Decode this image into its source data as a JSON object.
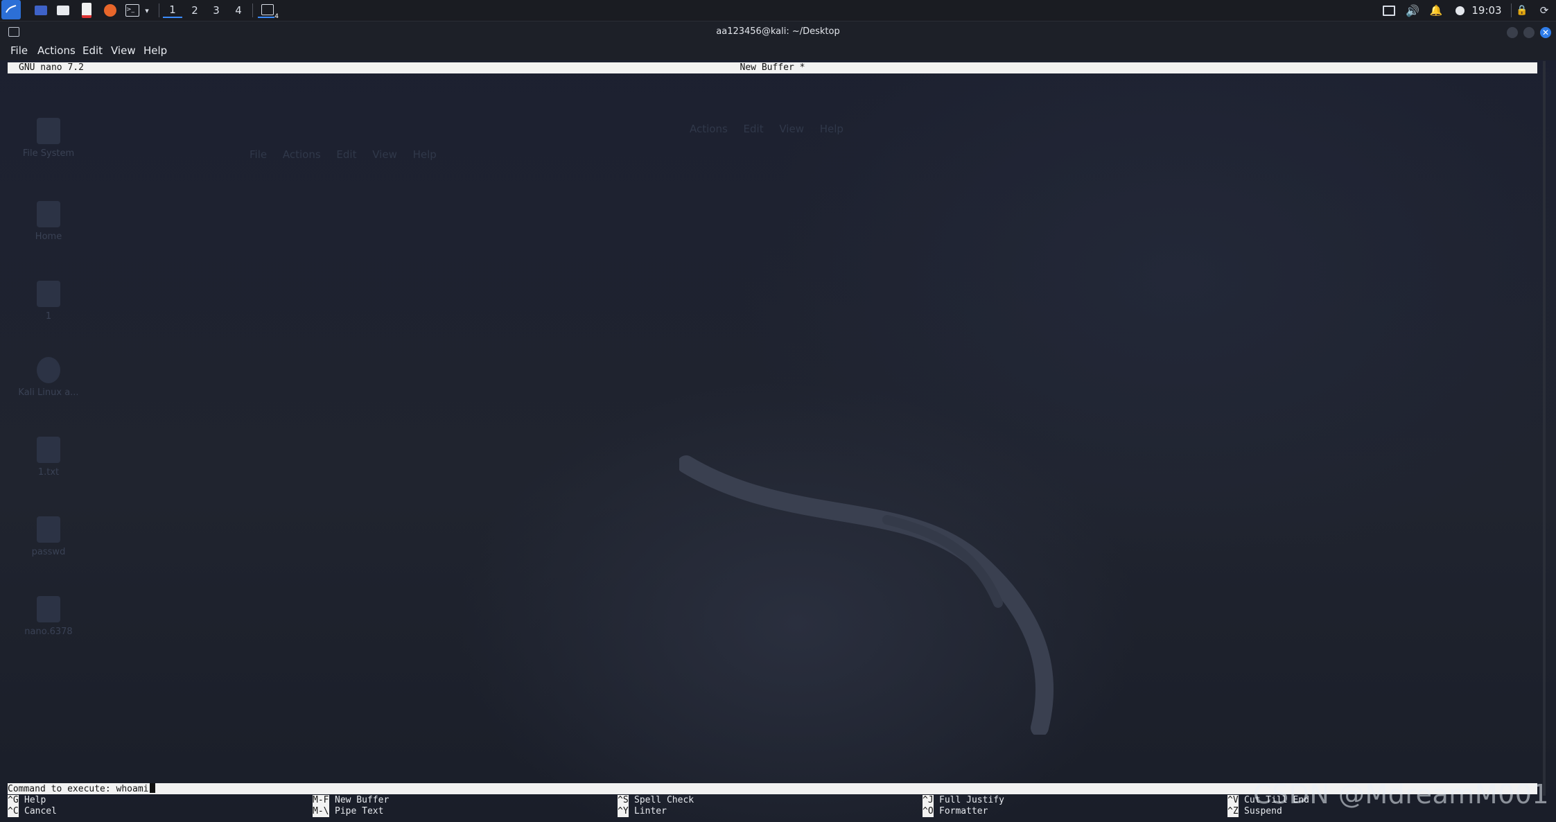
{
  "taskbar": {
    "workspaces": [
      "1",
      "2",
      "3",
      "4"
    ],
    "active_workspace": "1",
    "terminal_badge": "4",
    "clock": "19:03"
  },
  "window": {
    "title": "aa123456@kali: ~/Desktop"
  },
  "menu": [
    "File",
    "Actions",
    "Edit",
    "View",
    "Help"
  ],
  "nano": {
    "version": "GNU nano 7.2",
    "buffer": "New Buffer *",
    "prompt": "Command to execute: whoami",
    "shortcuts": [
      {
        "key1": "^G",
        "label1": "Help",
        "key2": "^C",
        "label2": "Cancel"
      },
      {
        "key1": "M-F",
        "label1": "New Buffer",
        "key2": "M-\\",
        "label2": "Pipe Text"
      },
      {
        "key1": "^S",
        "label1": "Spell Check",
        "key2": "^Y",
        "label2": "Linter"
      },
      {
        "key1": "^J",
        "label1": "Full Justify",
        "key2": "^O",
        "label2": "Formatter"
      },
      {
        "key1": "^V",
        "label1": "Cut Till End",
        "key2": "^Z",
        "label2": "Suspend"
      }
    ]
  },
  "watermark": "CSDN @MdreamM001",
  "desktop_icons": [
    "File System",
    "Home",
    "1",
    "Kali Linux a...",
    "1.txt",
    "passwd",
    "nano.6378"
  ]
}
